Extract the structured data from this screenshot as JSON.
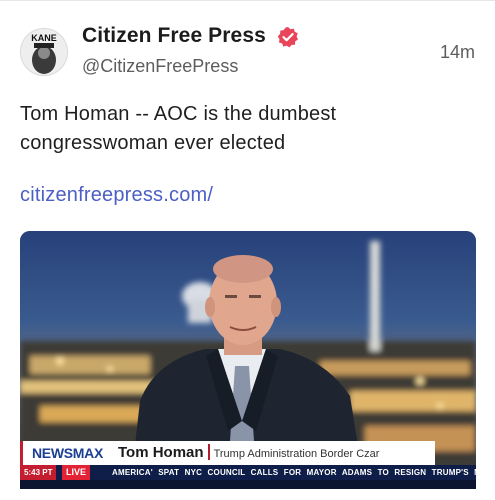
{
  "post": {
    "author": {
      "display_name": "Citizen Free Press",
      "handle": "@CitizenFreePress",
      "avatar_text": "KANE",
      "verified_color": "#e8445a"
    },
    "timestamp": "14m",
    "text": "Tom Homan -- AOC is the dumbest congresswoman ever elected",
    "link": "citizenfreepress.com/",
    "link_color": "#4b5fc5"
  },
  "media": {
    "network": "NEWSMAX",
    "lower_third_name": "Tom Homan",
    "lower_third_title": "Trump Administration Border Czar",
    "ticker_time": "5:43 PT",
    "ticker_live": "LIVE",
    "ticker_text": "AMERICA' SPAT    NYC COUNCIL CALLS FOR MAYOR ADAMS TO RESIGN    TRUMP'S NEW L",
    "brand_colors": {
      "red": "#c31d2f",
      "navy": "#0e1e48",
      "blue": "#1c3f94"
    }
  }
}
